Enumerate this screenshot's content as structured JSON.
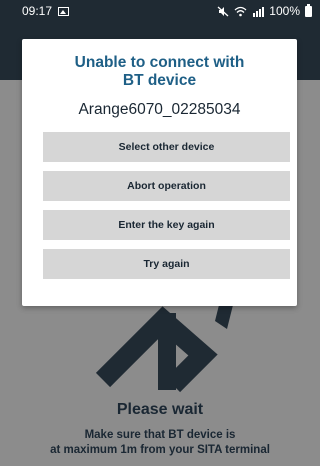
{
  "status_bar": {
    "time": "09:17",
    "battery": "100%"
  },
  "background": {
    "title": "Please wait",
    "message_line1": "Make sure that BT device is",
    "message_line2": "at maximum 1m from your SITA terminal"
  },
  "dialog": {
    "title_line1": "Unable to connect with",
    "title_line2": "BT device",
    "device_name": "Arange6070_02285034",
    "buttons": {
      "select_other": "Select other device",
      "abort": "Abort operation",
      "enter_key": "Enter the key again",
      "try_again": "Try again"
    }
  },
  "colors": {
    "accent": "#1e5f86",
    "dark_bar": "#1f2a33",
    "button_bg": "#d6d6d6",
    "overlay": "#8c8c8c"
  },
  "icons": [
    "image-icon",
    "mute-icon",
    "wifi-icon",
    "signal-icon",
    "battery-icon",
    "bluetooth-icon"
  ]
}
